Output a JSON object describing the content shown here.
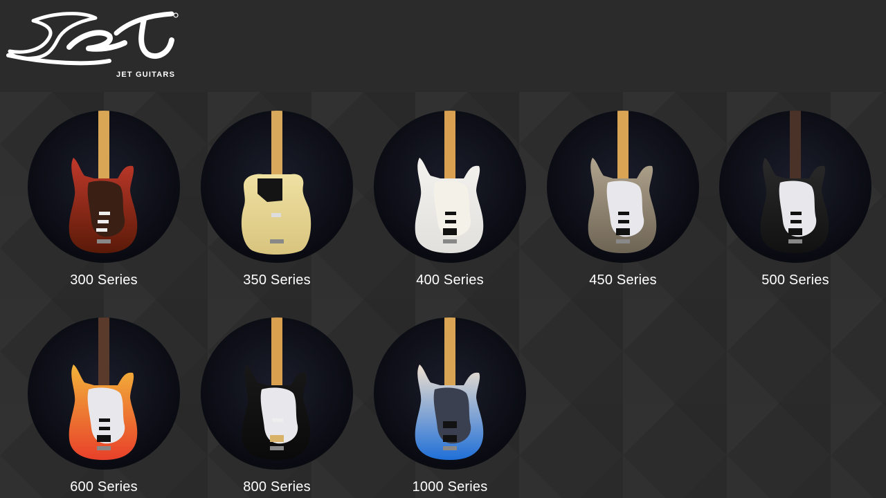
{
  "brand": {
    "logo_word": "Jet",
    "logo_sub": "JET GUITARS"
  },
  "series": [
    {
      "label": "300 Series",
      "body_top": "#c0392b",
      "body_bottom": "#5a1a08",
      "neck": "#d9a655",
      "guard": "#3a1f14",
      "pickups": "sss"
    },
    {
      "label": "350 Series",
      "body_top": "#efe1a2",
      "body_bottom": "#d8c47e",
      "neck": "#d8a95c",
      "guard": "#141414",
      "pickups": "tele"
    },
    {
      "label": "400 Series",
      "body_top": "#f4f2ee",
      "body_bottom": "#e2e0dc",
      "neck": "#d8a050",
      "guard": "#f4f1e8",
      "pickups": "hss"
    },
    {
      "label": "450 Series",
      "body_top": "#b0a48e",
      "body_bottom": "#6e6454",
      "neck": "#d9a454",
      "guard": "#e8e8ec",
      "pickups": "hss"
    },
    {
      "label": "500 Series",
      "body_top": "#2a2a2a",
      "body_bottom": "#111111",
      "neck": "#4a3228",
      "guard": "#e8e8ec",
      "pickups": "hss"
    },
    {
      "label": "600 Series",
      "body_top": "#f2b33a",
      "body_bottom": "#e8402a",
      "neck": "#5a3a2a",
      "guard": "#e8e8ec",
      "pickups": "hss"
    },
    {
      "label": "800 Series",
      "body_top": "#181818",
      "body_bottom": "#0a0a0a",
      "neck": "#d9a050",
      "guard": "#e8e8ec",
      "pickups": "hs"
    },
    {
      "label": "1000 Series",
      "body_top": "#efe0cf",
      "body_bottom": "#1f6fd8",
      "neck": "#d9a454",
      "guard": "#3a4050",
      "pickups": "hh"
    }
  ]
}
